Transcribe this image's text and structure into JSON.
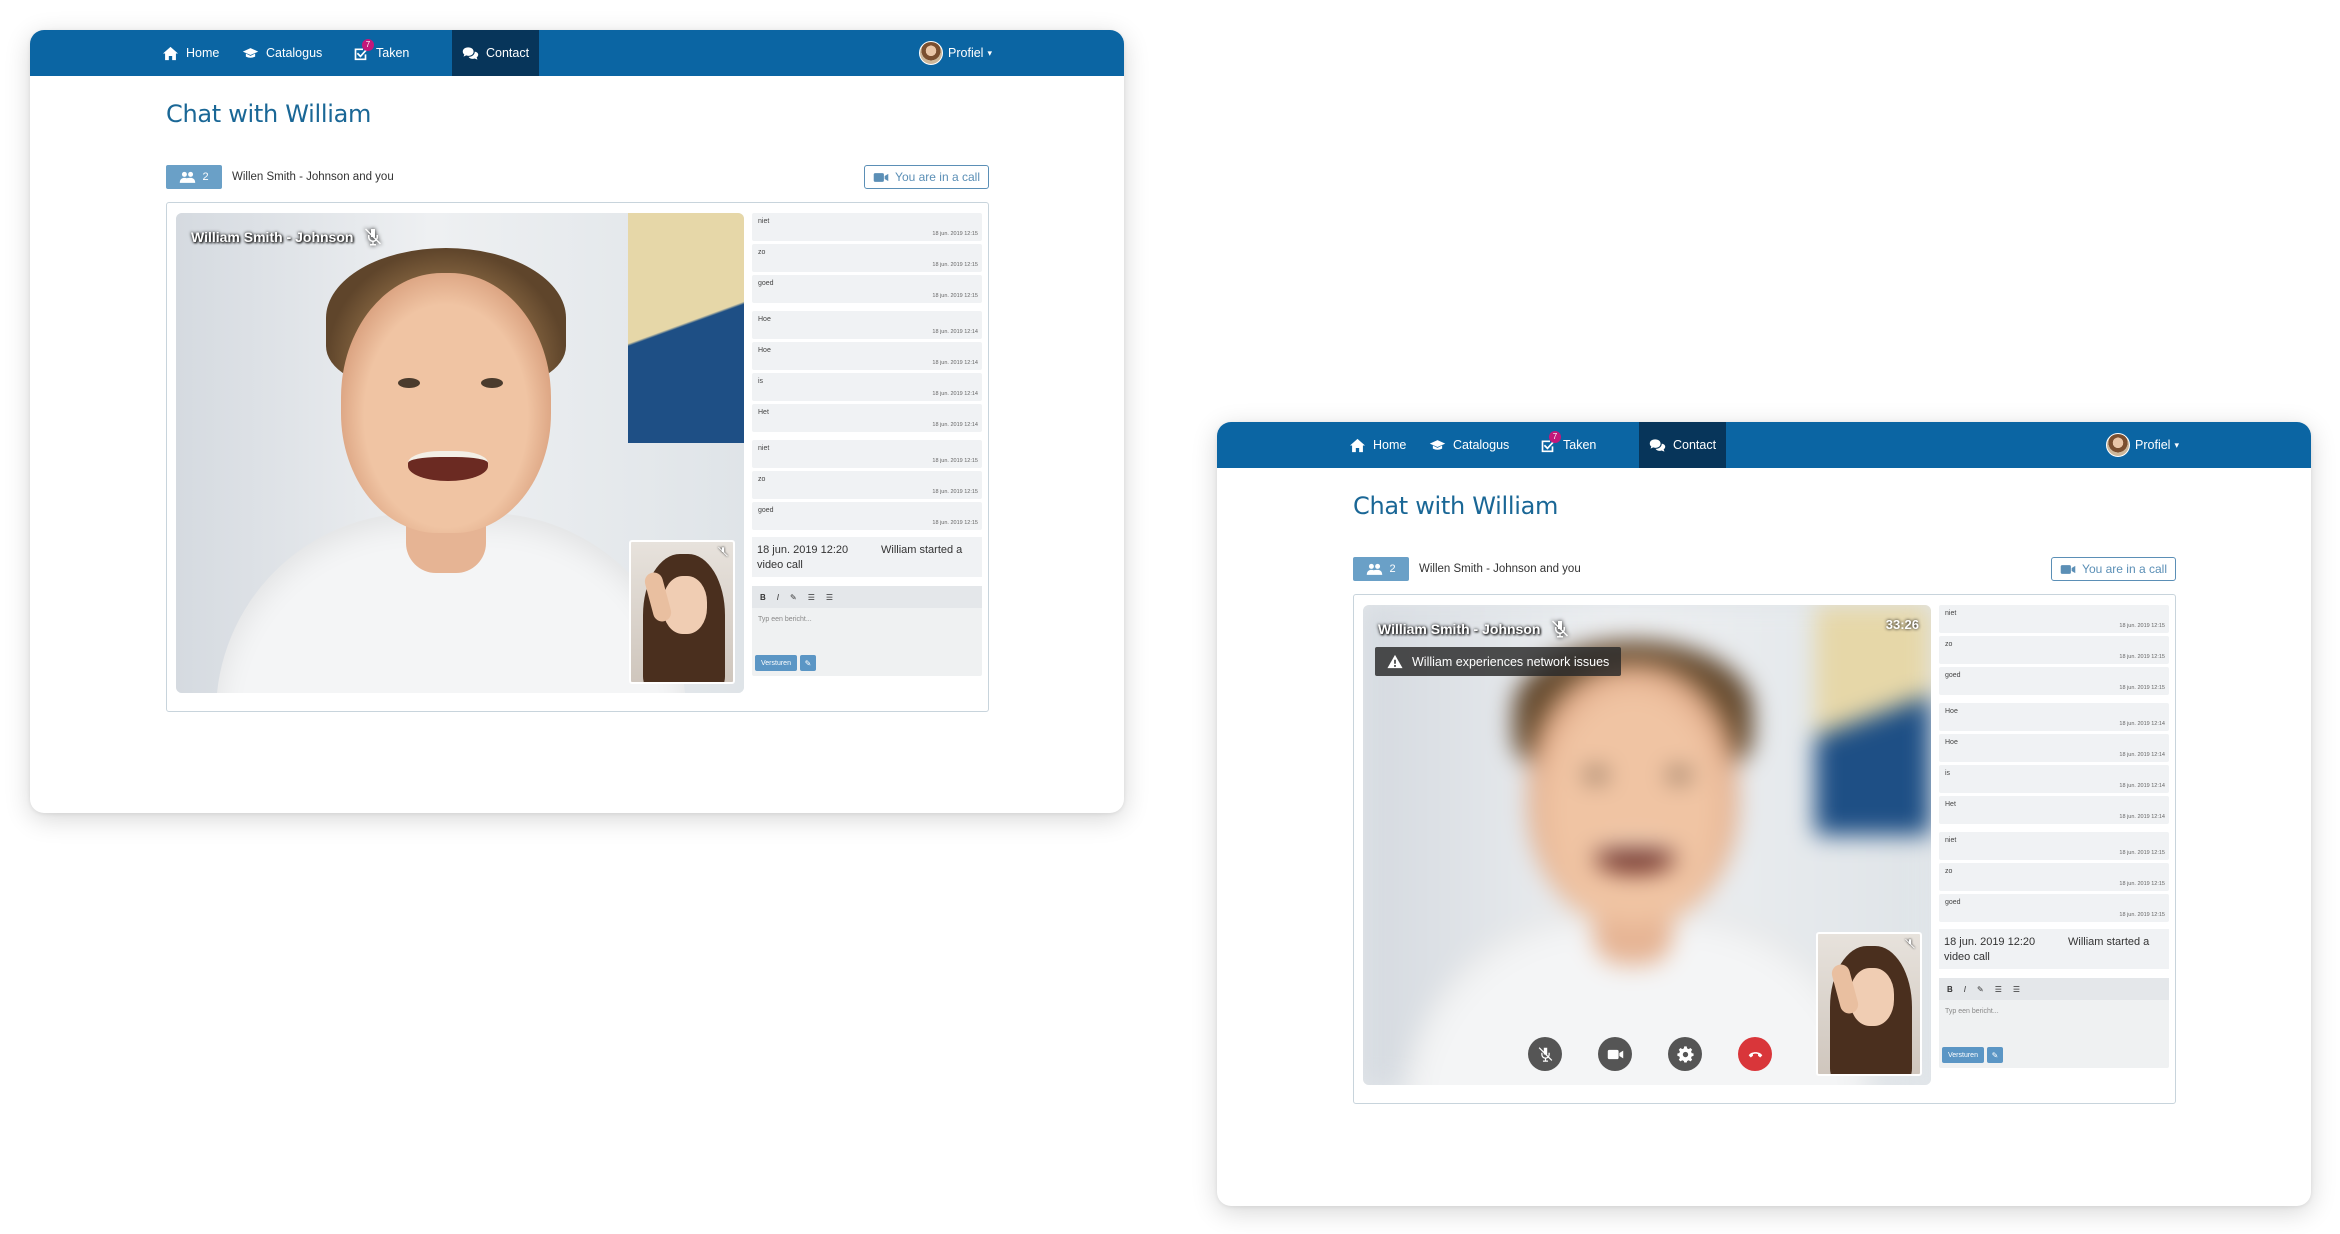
{
  "nav": {
    "home": "Home",
    "catalogue": "Catalogus",
    "tasks": "Taken",
    "tasks_badge": "7",
    "contact": "Contact",
    "profile": "Profiel"
  },
  "page": {
    "title": "Chat with William",
    "member_count": "2",
    "members_text": "Willen Smith - Johnson and you",
    "call_status": "You are in a call"
  },
  "video": {
    "caller_name": "William Smith - Johnson",
    "timer": "33:26",
    "network_warning": "William experiences network issues"
  },
  "messages": [
    {
      "text": "niet",
      "time": "18 jun. 2019 12:15"
    },
    {
      "text": "zo",
      "time": "18 jun. 2019 12:15"
    },
    {
      "text": "goed",
      "time": "18 jun. 2019 12:15"
    },
    {
      "text": "Hoe",
      "time": "18 jun. 2019 12:14"
    },
    {
      "text": "Hoe",
      "time": "18 jun. 2019 12:14"
    },
    {
      "text": "is",
      "time": "18 jun. 2019 12:14"
    },
    {
      "text": "Het",
      "time": "18 jun. 2019 12:14"
    },
    {
      "text": "niet",
      "time": "18 jun. 2019 12:15"
    },
    {
      "text": "zo",
      "time": "18 jun. 2019 12:15"
    },
    {
      "text": "goed",
      "time": "18 jun. 2019 12:15"
    }
  ],
  "system_message": {
    "date": "18 jun. 2019 12:20",
    "text": "William started a video call"
  },
  "editor": {
    "bold": "B",
    "italic": "I",
    "link": "✎",
    "list_bullet": "☰",
    "list_number": "☰",
    "placeholder": "Typ een bericht...",
    "send": "Versturen",
    "attach": "✎"
  },
  "colors": {
    "navbar": "#0b65a3",
    "nav_active": "#07355a",
    "title": "#1a6796",
    "badge": "#c2187a",
    "hangup": "#d9363a"
  }
}
